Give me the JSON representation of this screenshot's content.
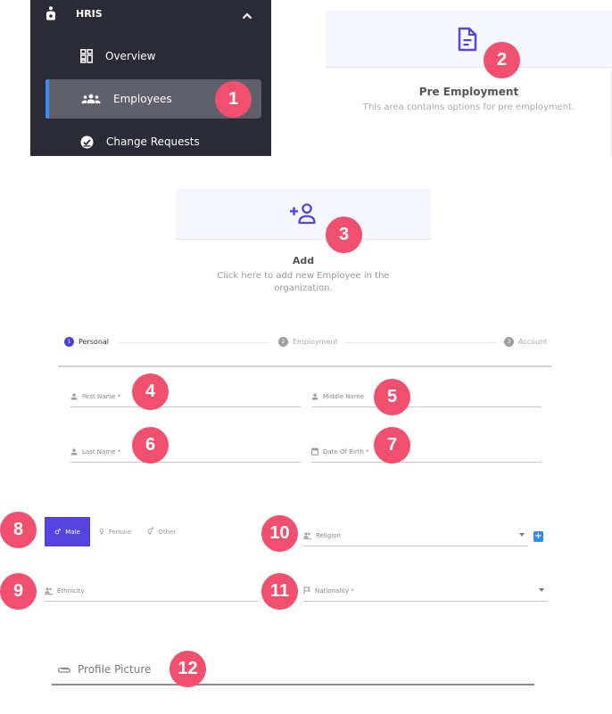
{
  "sidebar": {
    "section_label": "HRIS",
    "items": [
      {
        "label": "Overview",
        "icon": "dashboard-icon",
        "active": false
      },
      {
        "label": "Employees",
        "icon": "people-icon",
        "active": true
      },
      {
        "label": "Change Requests",
        "icon": "check-circle-icon",
        "active": false
      }
    ],
    "accent_color": "#3b8af5"
  },
  "pre_employment": {
    "title": "Pre Employment",
    "description": "This area contains options for pre employment.",
    "icon": "document-icon"
  },
  "add_employee": {
    "title": "Add",
    "description": "Click here to add new Employee in the organization.",
    "icon": "add-person-icon"
  },
  "stepper": {
    "steps": [
      {
        "number": "1",
        "label": "Personal",
        "active": true
      },
      {
        "number": "2",
        "label": "Employment",
        "active": false
      },
      {
        "number": "3",
        "label": "Account",
        "active": false
      }
    ]
  },
  "form": {
    "first_name": {
      "label": "First Name *",
      "value": ""
    },
    "middle_name": {
      "label": "Middle Name",
      "value": ""
    },
    "last_name": {
      "label": "Last Name *",
      "value": ""
    },
    "date_of_birth": {
      "label": "Date Of Birth *",
      "value": ""
    },
    "gender": {
      "options": [
        {
          "label": "Male",
          "symbol": "♂",
          "selected": true
        },
        {
          "label": "Female",
          "symbol": "♀",
          "selected": false
        },
        {
          "label": "Other",
          "symbol": "⚥",
          "selected": false
        }
      ]
    },
    "religion": {
      "label": "Religion",
      "value": "",
      "add_label": "+"
    },
    "ethnicity": {
      "label": "Ethnicity",
      "value": ""
    },
    "nationality": {
      "label": "Nationality *",
      "value": ""
    },
    "profile_picture": {
      "label": "Profile Picture"
    }
  },
  "annotations": [
    "1",
    "2",
    "3",
    "4",
    "5",
    "6",
    "7",
    "8",
    "9",
    "10",
    "11",
    "12"
  ],
  "colors": {
    "primary": "#5544e0",
    "badge": "#f0506e",
    "sidebar_bg": "#2a2b36"
  }
}
